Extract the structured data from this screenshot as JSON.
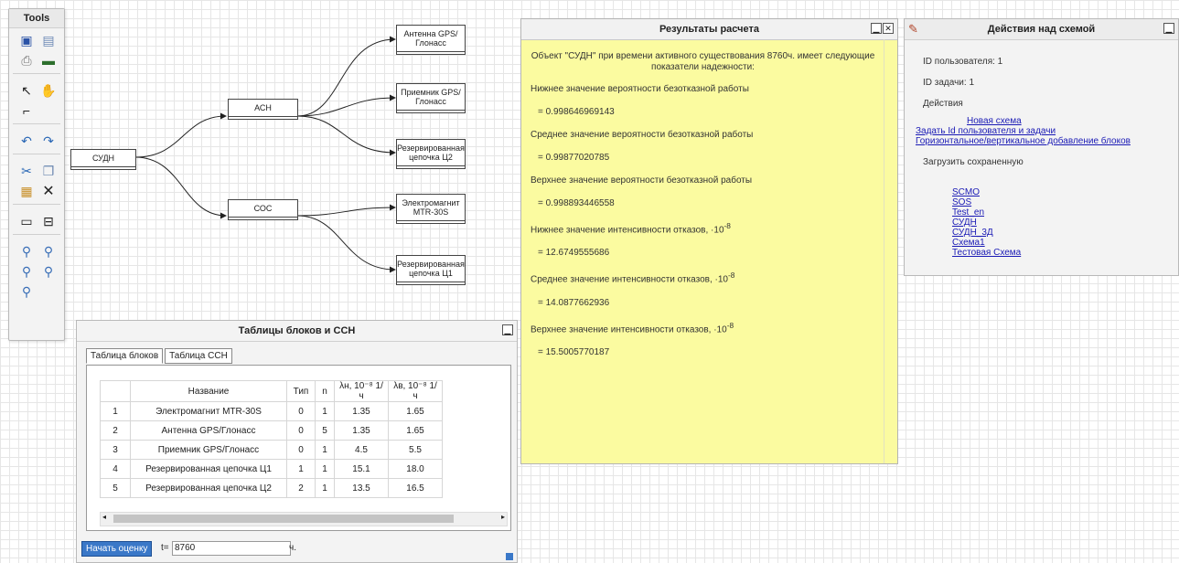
{
  "tools": {
    "title": "Tools"
  },
  "diagram": {
    "blocks": {
      "sudn": "СУДН",
      "ash": "АСН",
      "sos": "СОС",
      "gps_antenna": "Антенна GPS/ Глонасс",
      "gps_receiver": "Приемник GPS/Глонасс",
      "reserved_c2": "Резервированная цепочка Ц2",
      "electromagnet": "Электромагнит MTR-30S",
      "reserved_c1": "Резервированная цепочка Ц1"
    }
  },
  "results": {
    "title": "Результаты расчета",
    "intro": "Объект \"СУДН\" при времени активного существования 8760ч. имеет следующие показатели надежности:",
    "items": [
      {
        "label": "Нижнее значение вероятности безотказной работы",
        "value": "= 0.998646969143"
      },
      {
        "label": "Среднее значение вероятности безотказной работы",
        "value": "= 0.99877020785"
      },
      {
        "label": "Верхнее значение вероятности безотказной работы",
        "value": "= 0.998893446558"
      },
      {
        "label": "Нижнее значение интенсивности отказов, ·10",
        "value": "= 12.6749555686"
      },
      {
        "label": "Среднее значение интенсивности отказов, ·10",
        "value": "= 14.0877662936"
      },
      {
        "label": "Верхнее значение интенсивности отказов, ·10",
        "value": "= 15.5005770187"
      }
    ],
    "exp": "-8"
  },
  "actions": {
    "title": "Действия над схемой",
    "user_id": "ID пользователя: 1",
    "task_id": "ID задачи: 1",
    "actions_label": "Действия",
    "links": [
      "Новая схема",
      "Задать Id пользователя и задачи",
      "Горизонтальное/вертикальное добавление блоков"
    ],
    "load_label": "Загрузить сохраненную",
    "saved": [
      "SCMO",
      "SOS",
      "Test_en",
      "СУДН",
      "СУДН_3Д",
      "Схема1",
      "Тестовая Схема"
    ]
  },
  "tables": {
    "title": "Таблицы блоков и ССН",
    "tabs": [
      "Таблица блоков",
      "Таблица ССН"
    ],
    "columns": [
      "",
      "Название",
      "Тип",
      "n",
      "λн, 10⁻⁸ 1/ч",
      "λв, 10⁻⁸ 1/ч"
    ],
    "rows": [
      [
        "1",
        "Электромагнит MTR-30S",
        "0",
        "1",
        "1.35",
        "1.65"
      ],
      [
        "2",
        "Антенна GPS/Глонасс",
        "0",
        "5",
        "1.35",
        "1.65"
      ],
      [
        "3",
        "Приемник GPS/Глонасс",
        "0",
        "1",
        "4.5",
        "5.5"
      ],
      [
        "4",
        "Резервированная цепочка Ц1",
        "1",
        "1",
        "15.1",
        "18.0"
      ],
      [
        "5",
        "Резервированная цепочка Ц2",
        "2",
        "1",
        "13.5",
        "16.5"
      ]
    ],
    "start_button": "Начать оценку",
    "t_label": "t=",
    "t_value": "8760",
    "t_unit": "ч."
  }
}
